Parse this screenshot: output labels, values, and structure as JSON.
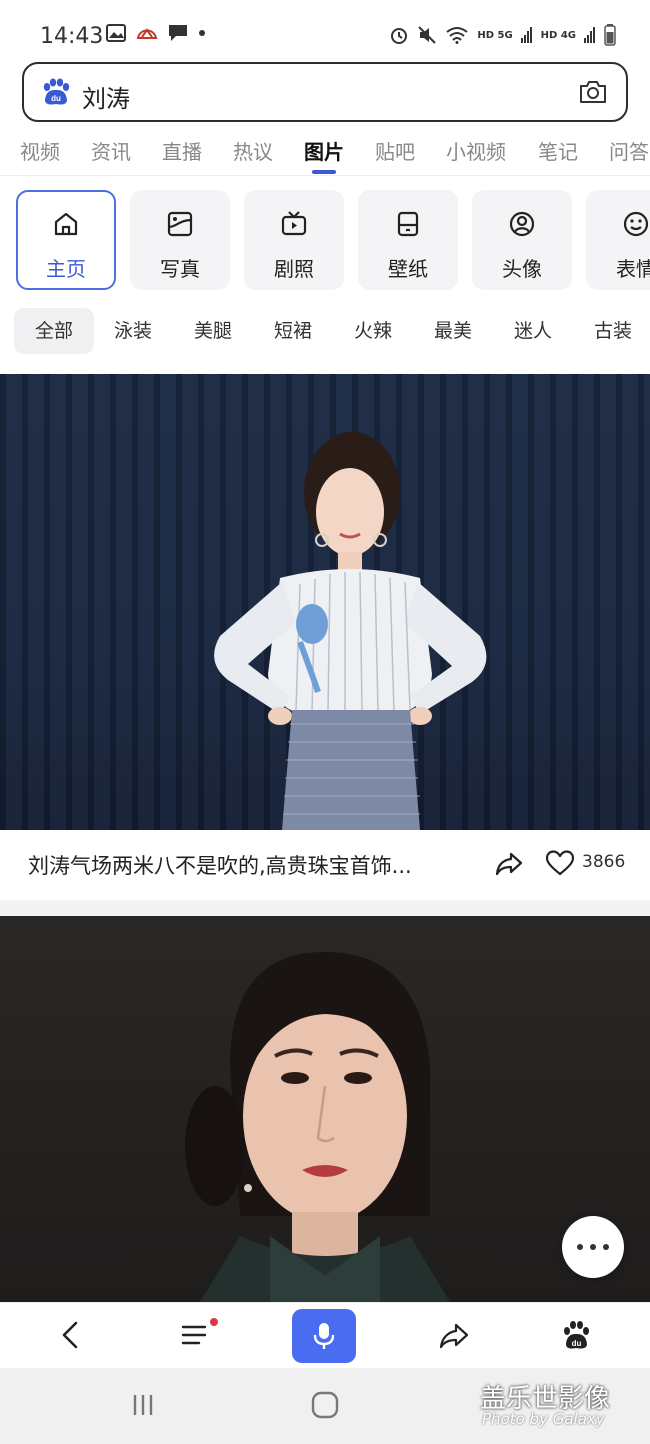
{
  "status": {
    "time": "14:43",
    "signal1": "HD 5G",
    "signal2": "HD 4G"
  },
  "search": {
    "query": "刘涛"
  },
  "top_tabs": [
    "视频",
    "资讯",
    "直播",
    "热议",
    "图片",
    "贴吧",
    "小视频",
    "笔记",
    "问答"
  ],
  "active_top_tab": "图片",
  "categories": [
    {
      "label": "主页",
      "icon": "home-icon"
    },
    {
      "label": "写真",
      "icon": "photo-frame-icon"
    },
    {
      "label": "剧照",
      "icon": "tv-play-icon"
    },
    {
      "label": "壁纸",
      "icon": "phone-wallpaper-icon"
    },
    {
      "label": "头像",
      "icon": "avatar-icon"
    },
    {
      "label": "表情",
      "icon": "smiley-icon"
    }
  ],
  "chips": [
    "全部",
    "泳装",
    "美腿",
    "短裙",
    "火辣",
    "最美",
    "迷人",
    "古装"
  ],
  "result1": {
    "caption": "刘涛气场两米八不是吹的,高贵珠宝首饰...",
    "likes": "3866"
  },
  "watermark": {
    "title": "盖乐世影像",
    "subtitle": "Photo by Galaxy"
  },
  "colors": {
    "accent": "#3a5ad4",
    "mic": "#4a6cf0",
    "notification_dot": "#e0344a"
  }
}
